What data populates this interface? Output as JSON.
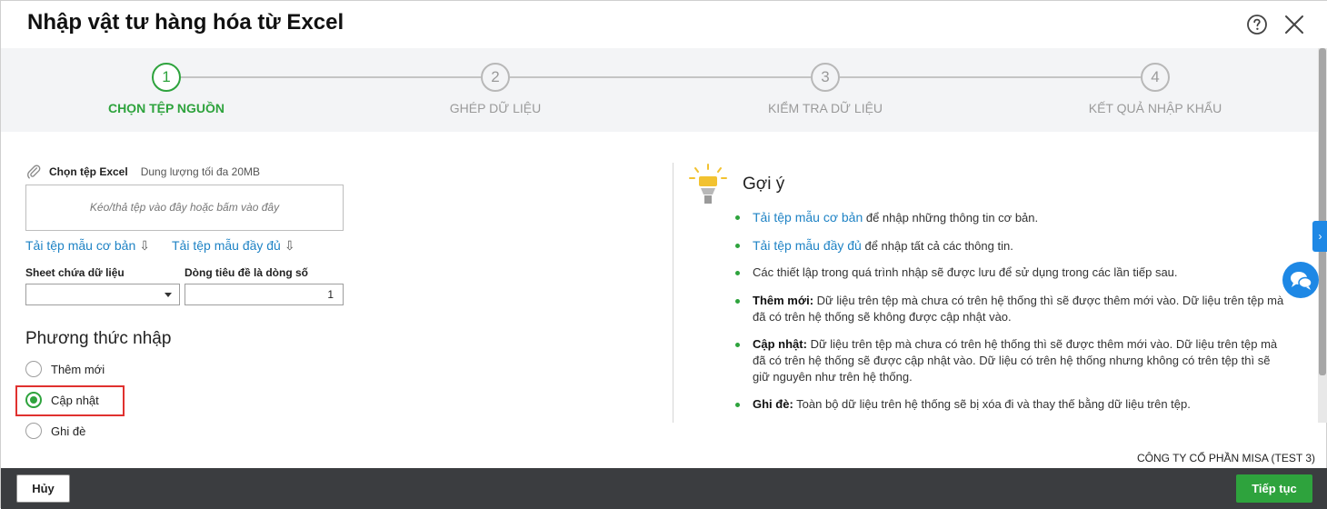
{
  "dialog": {
    "title": "Nhập vật tư hàng hóa từ Excel",
    "help_icon": "question-circle-icon",
    "close_icon": "close-x-icon"
  },
  "steps": [
    {
      "number": "1",
      "label": "CHỌN TỆP NGUỒN",
      "active": true
    },
    {
      "number": "2",
      "label": "GHÉP DỮ LIỆU",
      "active": false
    },
    {
      "number": "3",
      "label": "KIỂM TRA DỮ LIỆU",
      "active": false
    },
    {
      "number": "4",
      "label": "KẾT QUẢ NHẬP KHẨU",
      "active": false
    }
  ],
  "file": {
    "label": "Chọn tệp Excel",
    "size_hint": "Dung lượng tối đa 20MB",
    "dropzone_text": "Kéo/thả tệp vào đây hoặc bấm vào đây",
    "download_basic": "Tải tệp mẫu cơ bản",
    "download_full": "Tải tệp mẫu đầy đủ",
    "download_arrow": "⇩"
  },
  "fields": {
    "sheet_label": "Sheet chứa dữ liệu",
    "sheet_value": "",
    "header_row_label": "Dòng tiêu đề là dòng số",
    "header_row_value": "1"
  },
  "import_method": {
    "title": "Phương thức nhập",
    "options": [
      {
        "label": "Thêm mới",
        "checked": false
      },
      {
        "label": "Cập nhật",
        "checked": true
      },
      {
        "label": "Ghi đè",
        "checked": false
      }
    ]
  },
  "hints": {
    "title": "Gợi ý",
    "items": [
      {
        "link": "Tải tệp mẫu cơ bản",
        "text": " để nhập những thông tin cơ bản."
      },
      {
        "link": "Tải tệp mẫu đầy đủ",
        "text": " để nhập tất cả các thông tin."
      },
      {
        "text": "Các thiết lập trong quá trình nhập sẽ được lưu để sử dụng trong các lần tiếp sau."
      },
      {
        "bold": "Thêm mới:",
        "text": " Dữ liệu trên tệp mà chưa có trên hệ thống thì sẽ được thêm mới vào. Dữ liệu trên tệp mà đã có trên hệ thống sẽ không được cập nhật vào."
      },
      {
        "bold": "Cập nhật:",
        "text": " Dữ liệu trên tệp mà chưa có trên hệ thống thì sẽ được thêm mới vào. Dữ liệu trên tệp mà đã có trên hệ thống sẽ được cập nhật vào. Dữ liệu có trên hệ thống nhưng không có trên tệp thì sẽ giữ nguyên như trên hệ thống."
      },
      {
        "bold": "Ghi đè:",
        "text": " Toàn bộ dữ liệu trên hệ thống sẽ bị xóa đi và thay thế bằng dữ liệu trên tệp."
      }
    ]
  },
  "company": "CÔNG TY CỔ PHẦN MISA (TEST 3)",
  "side_tab_glyph": "›",
  "footer": {
    "cancel_label": "Hủy",
    "continue_label": "Tiếp tục"
  },
  "colors": {
    "accent_green": "#2ea33d",
    "link_blue": "#1f83c5",
    "highlight_red": "#e0312f",
    "footer_bg": "#3b3d40"
  }
}
